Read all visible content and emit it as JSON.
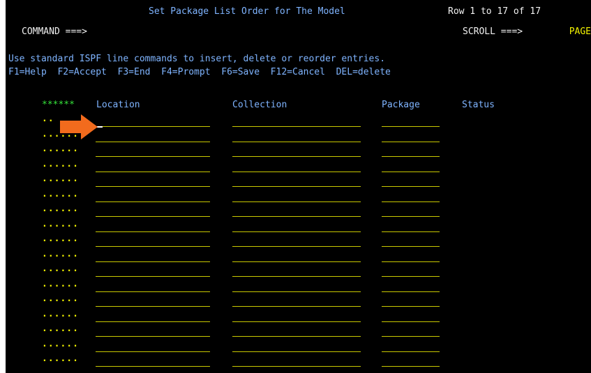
{
  "panel": {
    "title": "Set Package List Order for The Model",
    "row_indicator": "Row 1 to 17 of 17"
  },
  "command_line": {
    "label": "COMMAND ===>",
    "value": "",
    "scroll_label": "SCROLL ===>",
    "scroll_value": "PAGE"
  },
  "instructions": {
    "line1": "Use standard ISPF line commands to insert, delete or reorder entries.",
    "function_keys": "F1=Help  F2=Accept  F3=End  F4=Prompt  F6=Save  F12=Cancel  DEL=delete"
  },
  "table": {
    "header_marker": "******",
    "columns": {
      "location": "Location",
      "collection": "Collection",
      "package": "Package",
      "status": "Status"
    },
    "first_row_prefix": "..",
    "row_prefix": "......",
    "rows": [
      {
        "location": "",
        "collection": "",
        "package": "",
        "status": ""
      },
      {
        "location": "",
        "collection": "",
        "package": "",
        "status": ""
      },
      {
        "location": "",
        "collection": "",
        "package": "",
        "status": ""
      },
      {
        "location": "",
        "collection": "",
        "package": "",
        "status": ""
      },
      {
        "location": "",
        "collection": "",
        "package": "",
        "status": ""
      },
      {
        "location": "",
        "collection": "",
        "package": "",
        "status": ""
      },
      {
        "location": "",
        "collection": "",
        "package": "",
        "status": ""
      },
      {
        "location": "",
        "collection": "",
        "package": "",
        "status": ""
      },
      {
        "location": "",
        "collection": "",
        "package": "",
        "status": ""
      },
      {
        "location": "",
        "collection": "",
        "package": "",
        "status": ""
      },
      {
        "location": "",
        "collection": "",
        "package": "",
        "status": ""
      },
      {
        "location": "",
        "collection": "",
        "package": "",
        "status": ""
      },
      {
        "location": "",
        "collection": "",
        "package": "",
        "status": ""
      },
      {
        "location": "",
        "collection": "",
        "package": "",
        "status": ""
      },
      {
        "location": "",
        "collection": "",
        "package": "",
        "status": ""
      },
      {
        "location": "",
        "collection": "",
        "package": "",
        "status": ""
      },
      {
        "location": "",
        "collection": "",
        "package": "",
        "status": ""
      }
    ]
  },
  "colors": {
    "background": "#000000",
    "title": "#7fb4ff",
    "text": "#f2f2f2",
    "prefix": "#f2f200",
    "marker": "#35e23a",
    "arrow": "#f26b1d"
  },
  "icons": {
    "pointer": "orange-arrow-icon"
  }
}
